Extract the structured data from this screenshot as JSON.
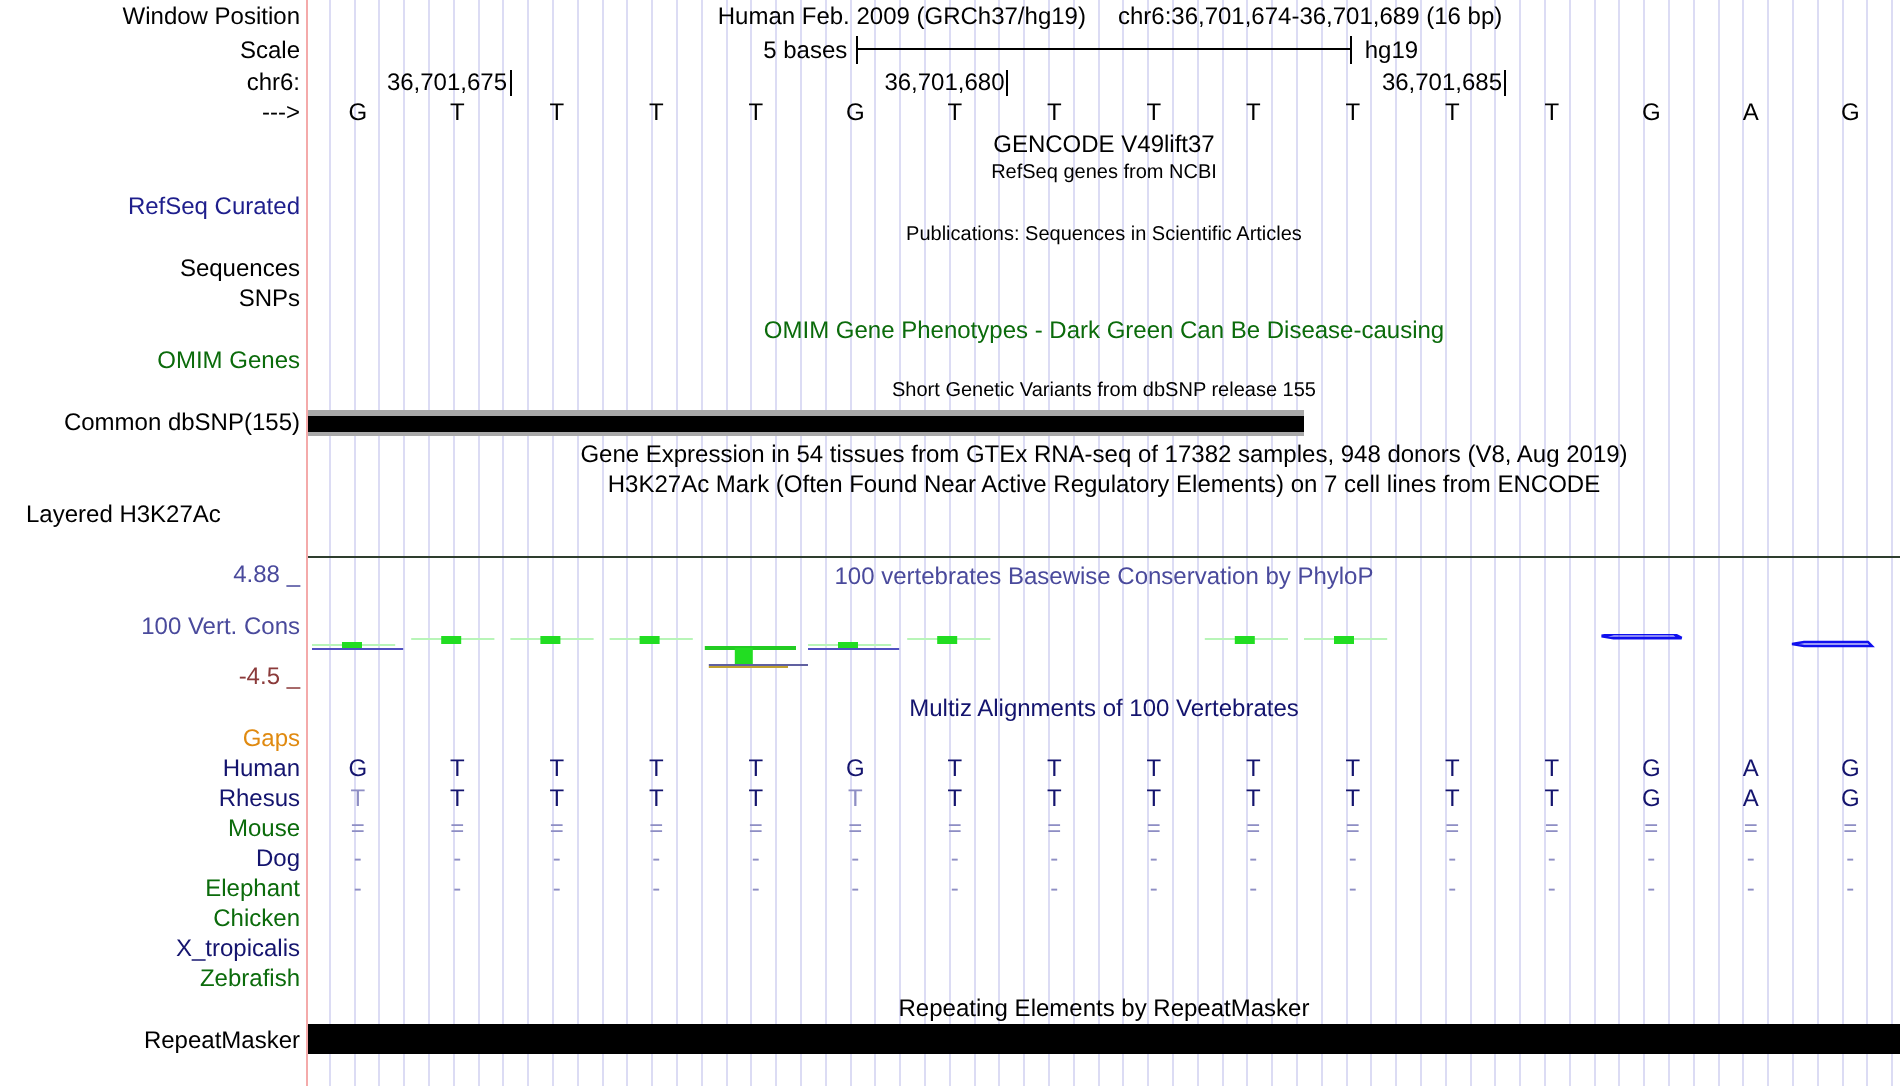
{
  "header": {
    "window_position": {
      "label": "Window Position",
      "assembly": "Human Feb. 2009 (GRCh37/hg19)",
      "range": "chr6:36,701,674-36,701,689 (16 bp)"
    },
    "scale": {
      "label": "Scale",
      "length": "5 bases",
      "assembly": "hg19"
    },
    "ruler": {
      "label": "chr6:",
      "ticks": [
        "36,701,675",
        "36,701,680",
        "36,701,685"
      ]
    },
    "sequence": {
      "label": "--->",
      "bases": [
        "G",
        "T",
        "T",
        "T",
        "T",
        "G",
        "T",
        "T",
        "T",
        "T",
        "T",
        "T",
        "T",
        "G",
        "A",
        "G"
      ]
    }
  },
  "tracks": [
    {
      "kind": "title",
      "text": "GENCODE V49lift37",
      "color": "#000000"
    },
    {
      "kind": "note",
      "text": "RefSeq genes from NCBI"
    },
    {
      "kind": "label",
      "label": "RefSeq Curated",
      "color": "#1e1e8c"
    },
    {
      "kind": "note",
      "text": "Publications: Sequences in Scientific Articles"
    },
    {
      "kind": "label",
      "label": "Sequences",
      "color": "#000000"
    },
    {
      "kind": "label",
      "label": "SNPs",
      "color": "#000000"
    },
    {
      "kind": "title",
      "text": "OMIM Gene Phenotypes - Dark Green Can Be Disease-causing",
      "color": "#0b6b0b"
    },
    {
      "kind": "label",
      "label": "OMIM Genes",
      "color": "#0b6b0b"
    },
    {
      "kind": "note",
      "text": "Short Genetic Variants from dbSNP release 155"
    },
    {
      "kind": "bar",
      "label": "Common dbSNP(155)",
      "color": "#000000",
      "level": 0.625,
      "outlined": true
    },
    {
      "kind": "title",
      "text": "Gene Expression in 54 tissues from GTEx RNA-seq of 17382 samples, 948 donors (V8, Aug 2019)",
      "color": "#000000"
    },
    {
      "kind": "title",
      "text": "H3K27Ac Mark (Often Found Near Active Regulatory Elements) on 7 cell lines from ENCODE",
      "color": "#000000"
    },
    {
      "kind": "composite",
      "label": "Layered H3K27Ac",
      "color": "#000000"
    },
    {
      "kind": "signal",
      "label": "100 Vert. Cons",
      "title": "100 vertebrates Basewise Conservation by PhyloP",
      "max": "4.88 _",
      "min": "-4.5 _",
      "color": "#4a4a9c"
    },
    {
      "kind": "title",
      "text": "Multiz Alignments of 100 Vertebrates",
      "color": "#14146e"
    },
    {
      "kind": "label",
      "label": "Gaps",
      "color": "#e08a10"
    },
    {
      "kind": "alignment",
      "label": "Human",
      "color": "#14146e",
      "bases": [
        {
          "text": "G",
          "match": true
        },
        {
          "text": "T",
          "match": true
        },
        {
          "text": "T",
          "match": true
        },
        {
          "text": "T",
          "match": true
        },
        {
          "text": "T",
          "match": true
        },
        {
          "text": "G",
          "match": true
        },
        {
          "text": "T",
          "match": true
        },
        {
          "text": "T",
          "match": true
        },
        {
          "text": "T",
          "match": true
        },
        {
          "text": "T",
          "match": true
        },
        {
          "text": "T",
          "match": true
        },
        {
          "text": "T",
          "match": true
        },
        {
          "text": "T",
          "match": true
        },
        {
          "text": "G",
          "match": true
        },
        {
          "text": "A",
          "match": true
        },
        {
          "text": "G",
          "match": true
        }
      ]
    },
    {
      "kind": "alignment",
      "label": "Rhesus",
      "color": "#14146e",
      "bases": [
        {
          "text": "T",
          "match": false
        },
        {
          "text": "T",
          "match": true
        },
        {
          "text": "T",
          "match": true
        },
        {
          "text": "T",
          "match": true
        },
        {
          "text": "T",
          "match": true
        },
        {
          "text": "T",
          "match": false
        },
        {
          "text": "T",
          "match": true
        },
        {
          "text": "T",
          "match": true
        },
        {
          "text": "T",
          "match": true
        },
        {
          "text": "T",
          "match": true
        },
        {
          "text": "T",
          "match": true
        },
        {
          "text": "T",
          "match": true
        },
        {
          "text": "T",
          "match": true
        },
        {
          "text": "G",
          "match": true
        },
        {
          "text": "A",
          "match": true
        },
        {
          "text": "G",
          "match": true
        }
      ]
    },
    {
      "kind": "alignment",
      "label": "Mouse",
      "color": "#0b6b0b",
      "bases": [
        {
          "text": "=",
          "match": false
        },
        {
          "text": "=",
          "match": false
        },
        {
          "text": "=",
          "match": false
        },
        {
          "text": "=",
          "match": false
        },
        {
          "text": "=",
          "match": false
        },
        {
          "text": "=",
          "match": false
        },
        {
          "text": "=",
          "match": false
        },
        {
          "text": "=",
          "match": false
        },
        {
          "text": "=",
          "match": false
        },
        {
          "text": "=",
          "match": false
        },
        {
          "text": "=",
          "match": false
        },
        {
          "text": "=",
          "match": false
        },
        {
          "text": "=",
          "match": false
        },
        {
          "text": "=",
          "match": false
        },
        {
          "text": "=",
          "match": false
        },
        {
          "text": "=",
          "match": false
        }
      ]
    },
    {
      "kind": "alignment",
      "label": "Dog",
      "color": "#14146e",
      "bases": [
        {
          "text": "-",
          "match": false
        },
        {
          "text": "-",
          "match": false
        },
        {
          "text": "-",
          "match": false
        },
        {
          "text": "-",
          "match": false
        },
        {
          "text": "-",
          "match": false
        },
        {
          "text": "-",
          "match": false
        },
        {
          "text": "-",
          "match": false
        },
        {
          "text": "-",
          "match": false
        },
        {
          "text": "-",
          "match": false
        },
        {
          "text": "-",
          "match": false
        },
        {
          "text": "-",
          "match": false
        },
        {
          "text": "-",
          "match": false
        },
        {
          "text": "-",
          "match": false
        },
        {
          "text": "-",
          "match": false
        },
        {
          "text": "-",
          "match": false
        },
        {
          "text": "-",
          "match": false
        }
      ]
    },
    {
      "kind": "alignment",
      "label": "Elephant",
      "color": "#0b6b0b",
      "bases": [
        {
          "text": "-",
          "match": false
        },
        {
          "text": "-",
          "match": false
        },
        {
          "text": "-",
          "match": false
        },
        {
          "text": "-",
          "match": false
        },
        {
          "text": "-",
          "match": false
        },
        {
          "text": "-",
          "match": false
        },
        {
          "text": "-",
          "match": false
        },
        {
          "text": "-",
          "match": false
        },
        {
          "text": "-",
          "match": false
        },
        {
          "text": "-",
          "match": false
        },
        {
          "text": "-",
          "match": false
        },
        {
          "text": "-",
          "match": false
        },
        {
          "text": "-",
          "match": false
        },
        {
          "text": "-",
          "match": false
        },
        {
          "text": "-",
          "match": false
        },
        {
          "text": "-",
          "match": false
        }
      ]
    },
    {
      "kind": "label",
      "label": "Chicken",
      "color": "#0b6b0b"
    },
    {
      "kind": "label",
      "label": "X_tropicalis",
      "color": "#14146e"
    },
    {
      "kind": "label",
      "label": "Zebrafish",
      "color": "#0b6b0b"
    },
    {
      "kind": "title",
      "text": "Repeating Elements by RepeatMasker",
      "color": "#000000"
    },
    {
      "kind": "bar",
      "label": "RepeatMasker",
      "color": "#000000",
      "level": 1,
      "outlined": false
    }
  ]
}
